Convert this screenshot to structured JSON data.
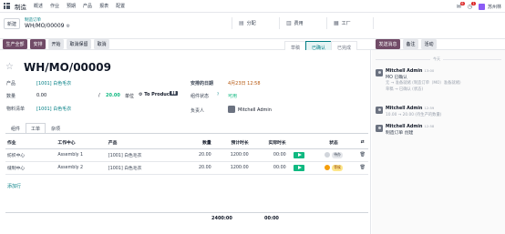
{
  "topbar": {
    "app_name": "制造",
    "menu": [
      "概述",
      "作业",
      "预期",
      "产品",
      "报表",
      "配置"
    ],
    "notif_count": "6",
    "chat_count": "1",
    "company": "苏州林"
  },
  "breadcrumb": {
    "new_label": "新建",
    "parent": "制造订单",
    "current": "WH/MO/00009"
  },
  "smart_buttons": [
    {
      "icon": "allocation-icon",
      "label": "分配"
    },
    {
      "icon": "cost-icon",
      "label": "费用"
    },
    {
      "icon": "workorder-icon",
      "label": "工厂"
    }
  ],
  "actions": [
    "生产全部",
    "安排",
    "开始",
    "取消保留",
    "取消"
  ],
  "stages": [
    "草稿",
    "已确认",
    "已完成"
  ],
  "active_stage": "已确认",
  "chatter_actions": [
    "发送消息",
    "备注",
    "活动"
  ],
  "record": {
    "name": "WH/MO/00009",
    "product_label": "产品",
    "product": "[1001] 白色毛衣",
    "quantity_label": "数量",
    "quantity": "0.00",
    "quantity_sep": "/",
    "quantity_target": "20.00",
    "uom": "单位",
    "to_produce": "To Produce",
    "bom_label": "物料清单",
    "bom": "[1001] 白色毛衣",
    "scheduled_label": "安排的日期",
    "scheduled": "4月23日 12:58",
    "component_status_label": "组件状态",
    "component_status": "可用",
    "responsible_label": "负责人",
    "responsible": "Mitchell Admin"
  },
  "tabs": [
    "组件",
    "工单",
    "杂项"
  ],
  "active_tab": "工单",
  "workorders": {
    "headers": [
      "作业",
      "工作中心",
      "产品",
      "数量",
      "预计时长",
      "实际时长",
      "",
      "状态"
    ],
    "rows": [
      {
        "op": "纺织中心",
        "wc": "Assembly 1",
        "product": "[1001] 白色毛衣",
        "qty": "20.00",
        "expected": "1200:00",
        "real": "00:00",
        "status": "待办",
        "status_color": "#d1d5db",
        "pill_bg": "#e5e7eb",
        "pill_fg": "#374151"
      },
      {
        "op": "缝制中心",
        "wc": "Assembly 2",
        "product": "[1001] 白色毛衣",
        "qty": "20.00",
        "expected": "1200:00",
        "real": "00:00",
        "status": "等候",
        "status_color": "#f59e0b",
        "pill_bg": "#fde68a",
        "pill_fg": "#92400e"
      }
    ],
    "add_line": "添加行",
    "total_expected": "2400:00",
    "total_real": "00:00"
  },
  "chatter": {
    "date_divider": "今天",
    "messages": [
      {
        "author": "Mitchell Admin",
        "time": "13:00",
        "lines": [
          "MO 已确认",
          "无 → 准备就绪 (制造订单（MO）准备就绪)",
          "草稿 → 已确认 (状态)"
        ]
      },
      {
        "author": "Mitchell Admin",
        "time": "12:59",
        "lines": [
          "10.00 → 20.00 (待生产的数量)"
        ]
      },
      {
        "author": "Mitchell Admin",
        "time": "12:58",
        "lines": [
          "制造订单 创建"
        ]
      }
    ]
  },
  "colors": {
    "brand": "#714b67",
    "accent": "#017e84",
    "success": "#10b981"
  }
}
